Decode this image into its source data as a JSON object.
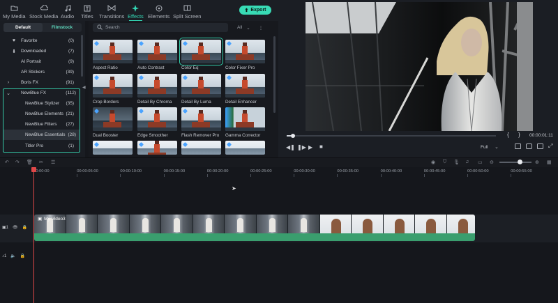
{
  "toolbar": {
    "tabs": [
      {
        "label": "My Media",
        "icon": "folder-icon"
      },
      {
        "label": "Stock Media",
        "icon": "cloud-icon"
      },
      {
        "label": "Audio",
        "icon": "music-icon"
      },
      {
        "label": "Titles",
        "icon": "text-icon"
      },
      {
        "label": "Transitions",
        "icon": "transition-icon"
      },
      {
        "label": "Effects",
        "icon": "sparkle-icon"
      },
      {
        "label": "Elements",
        "icon": "elements-icon"
      },
      {
        "label": "Split Screen",
        "icon": "split-screen-icon"
      }
    ],
    "active_tab": "Effects",
    "export_label": "Export"
  },
  "sidebar": {
    "tabs": [
      "Default",
      "Filmstock"
    ],
    "active_tab": "Default",
    "items": [
      {
        "label": "Favorite",
        "count": "(0)",
        "icon": "heart-icon"
      },
      {
        "label": "Downloaded",
        "count": "(7)",
        "icon": "download-icon"
      },
      {
        "label": "AI Portrait",
        "count": "(9)"
      },
      {
        "label": "AR Stickers",
        "count": "(39)"
      },
      {
        "label": "Boris FX",
        "count": "(91)",
        "icon": "chevron-right-icon"
      },
      {
        "label": "NewBlue FX",
        "count": "(112)",
        "icon": "chevron-down-icon"
      },
      {
        "label": "NewBlue Stylizer",
        "count": "(35)"
      },
      {
        "label": "NewBlue Elements",
        "count": "(21)"
      },
      {
        "label": "NewBlue Filters",
        "count": "(27)"
      },
      {
        "label": "NewBlue Essentials",
        "count": "(28)"
      },
      {
        "label": "Titler Pro",
        "count": "(1)"
      }
    ],
    "selected": "NewBlue Essentials"
  },
  "effects": {
    "search_placeholder": "Search",
    "filter": "All",
    "items": [
      {
        "label": "Aspect Ratio"
      },
      {
        "label": "Auto Contrast"
      },
      {
        "label": "Color Eq"
      },
      {
        "label": "Color Fixer Pro"
      },
      {
        "label": "Crop Borders"
      },
      {
        "label": "Detail By Chroma"
      },
      {
        "label": "Detail By Luma"
      },
      {
        "label": "Detail Enhancer"
      },
      {
        "label": "Dual Booster"
      },
      {
        "label": "Edge Smoother"
      },
      {
        "label": "Flash Remover Pro"
      },
      {
        "label": "Gamma Corrector"
      }
    ],
    "selected": "Color Eq"
  },
  "preview": {
    "timecode": "00:00:01:11",
    "quality": "Full",
    "progress": 0.02
  },
  "timeline": {
    "ruler": [
      "00:00:00",
      "00:00:05:00",
      "00:00:10:00",
      "00:00:15:00",
      "00:00:20:00",
      "00:00:25:00",
      "00:00:30:00",
      "00:00:35:00",
      "00:00:40:00",
      "00:00:45:00",
      "00:00:50:00",
      "00:00:55:00"
    ],
    "clip_title": "My Video3",
    "video_track": "1",
    "audio_track": "1"
  },
  "colors": {
    "accent": "#38dbb5",
    "playhead": "#e04848",
    "audio": "#3a9e6e"
  }
}
